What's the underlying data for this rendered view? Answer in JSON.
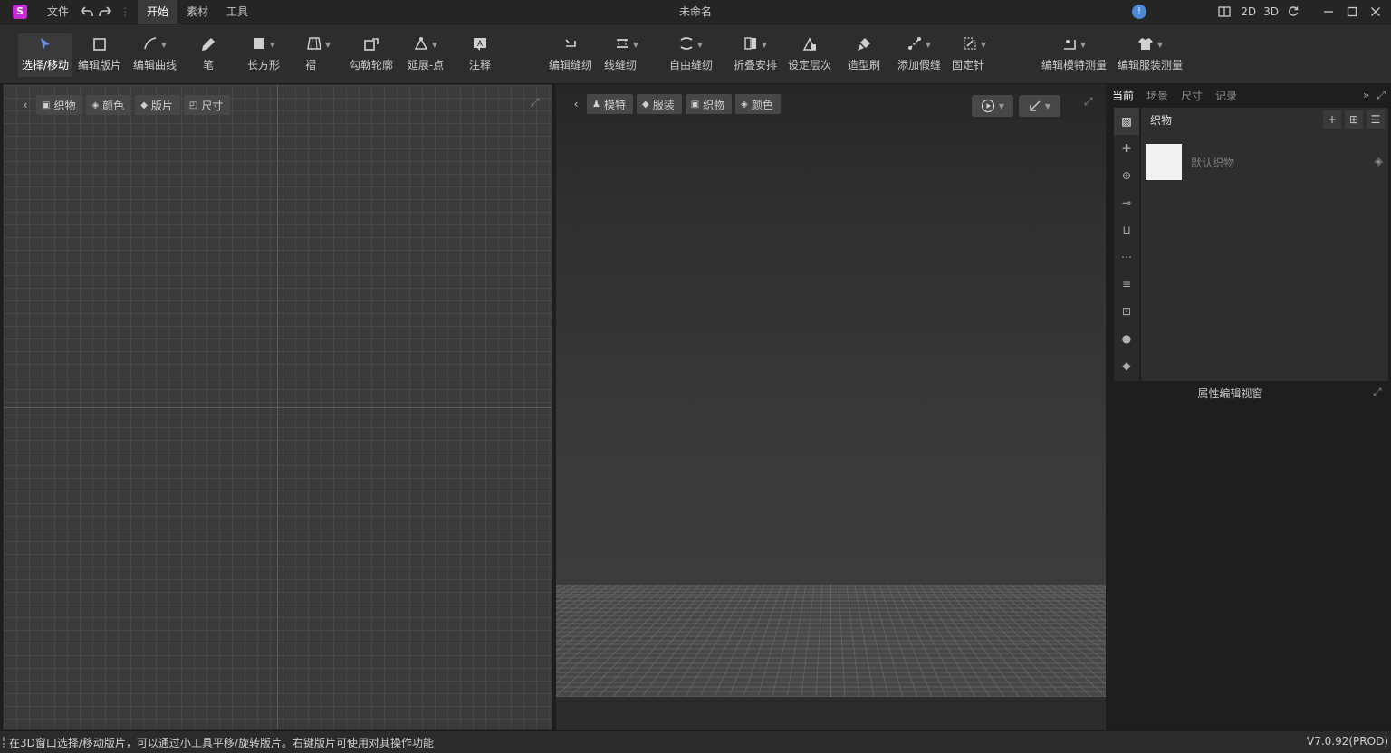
{
  "app": {
    "title": "未命名",
    "logo_glyph": "S",
    "logo_color": "#c62bd6"
  },
  "menu": {
    "file": "文件",
    "tabs": [
      "开始",
      "素材",
      "工具"
    ],
    "active_tab": 0
  },
  "view_modes": {
    "mode2d": "2D",
    "mode3d": "3D"
  },
  "toolbar": {
    "tools": [
      {
        "label": "选择/移动",
        "icon": "select-move-icon",
        "active": true
      },
      {
        "label": "编辑版片",
        "icon": "edit-pattern-icon"
      },
      {
        "label": "编辑曲线",
        "icon": "edit-curve-icon",
        "dropdown": true
      },
      {
        "label": "笔",
        "icon": "pen-icon"
      },
      {
        "label": "长方形",
        "icon": "rectangle-icon",
        "dropdown": true
      },
      {
        "label": "褶",
        "icon": "pleat-icon",
        "dropdown": true
      },
      {
        "label": "勾勒轮廓",
        "icon": "trace-outline-icon"
      },
      {
        "label": "延展-点",
        "icon": "extend-point-icon",
        "dropdown": true
      },
      {
        "label": "注释",
        "icon": "annotation-icon"
      },
      {
        "label": "编辑缝纫",
        "icon": "edit-sewing-icon"
      },
      {
        "label": "线缝纫",
        "icon": "line-sewing-icon",
        "dropdown": true
      },
      {
        "label": "自由缝纫",
        "icon": "free-sewing-icon",
        "dropdown": true
      },
      {
        "label": "折叠安排",
        "icon": "fold-arrange-icon",
        "dropdown": true
      },
      {
        "label": "设定层次",
        "icon": "set-layer-icon"
      },
      {
        "label": "造型刷",
        "icon": "shape-brush-icon"
      },
      {
        "label": "添加假缝",
        "icon": "add-tack-icon",
        "dropdown": true
      },
      {
        "label": "固定针",
        "icon": "pin-icon",
        "dropdown": true
      },
      {
        "label": "编辑模特测量",
        "icon": "avatar-measure-icon",
        "dropdown": true
      },
      {
        "label": "编辑服装测量",
        "icon": "garment-measure-icon",
        "dropdown": true
      }
    ]
  },
  "panel2d": {
    "chips": [
      "织物",
      "颜色",
      "版片",
      "尺寸"
    ]
  },
  "panel3d": {
    "chips": [
      "模特",
      "服装",
      "织物",
      "颜色"
    ]
  },
  "rightpanel": {
    "tabs": [
      "当前",
      "场景",
      "尺寸",
      "记录"
    ],
    "active_tab": 0,
    "section_title": "织物",
    "fabric_name": "默认织物",
    "swatch_color": "#f2f2f2",
    "property_title": "属性编辑视窗"
  },
  "status": {
    "text": "在3D窗口选择/移动版片，可以通过小工具平移/旋转版片。右键版片可使用对其操作功能",
    "version": "V7.0.92(PROD)"
  }
}
